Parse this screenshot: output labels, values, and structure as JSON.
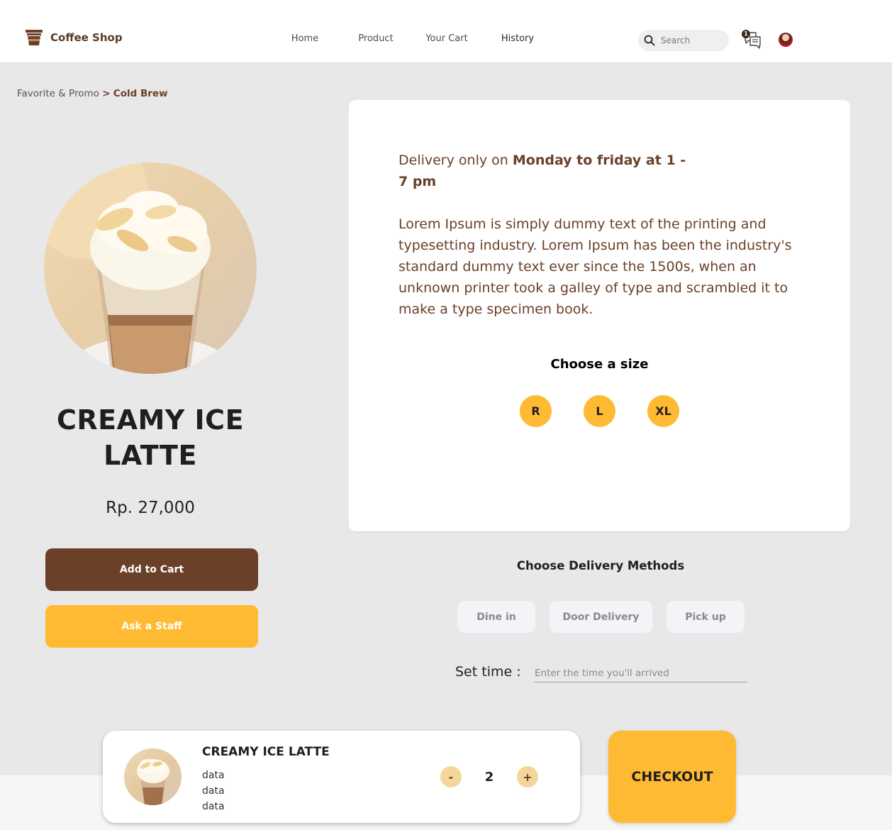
{
  "header": {
    "logo_text": "Coffee Shop",
    "logo_icon": "coffee-cup-icon",
    "nav": [
      "Home",
      "Product",
      "Your Cart",
      "History"
    ],
    "search_placeholder": "Search",
    "chat_badge": "1",
    "chat_icon": "chat-icon",
    "search_icon": "search-icon"
  },
  "breadcrumb": {
    "parent": "Favorite & Promo",
    "separator": ">",
    "current": "Cold Brew"
  },
  "product": {
    "name": "CREAMY ICE LATTE",
    "price": "Rp. 27,000",
    "add_to_cart": "Add to Cart",
    "ask_staff": "Ask a Staff"
  },
  "info": {
    "delivery_prefix": "Delivery only on",
    "delivery_days": "Monday to friday at 1 - 7 pm",
    "description": "Lorem Ipsum is simply dummy text of the printing and typesetting industry. Lorem Ipsum has been the industry's standard dummy text ever since the 1500s, when an unknown printer took a galley of type and scrambled it to make a type specimen book.",
    "size_title": "Choose a size",
    "sizes": [
      "R",
      "L",
      "XL"
    ]
  },
  "delivery": {
    "title": "Choose Delivery Methods",
    "methods": [
      "Dine in",
      "Door Delivery",
      "Pick up"
    ],
    "set_time_label": "Set time :",
    "time_placeholder": "Enter the time you'll arrived"
  },
  "cart_summary": {
    "name": "CREAMY ICE LATTE",
    "details": [
      "data",
      "data",
      "data"
    ],
    "minus": "-",
    "plus": "+",
    "quantity": "2"
  },
  "checkout_label": "CHECKOUT",
  "colors": {
    "brown": "#6a4029",
    "yellow": "#ffba33",
    "background": "#e8e8e8"
  }
}
